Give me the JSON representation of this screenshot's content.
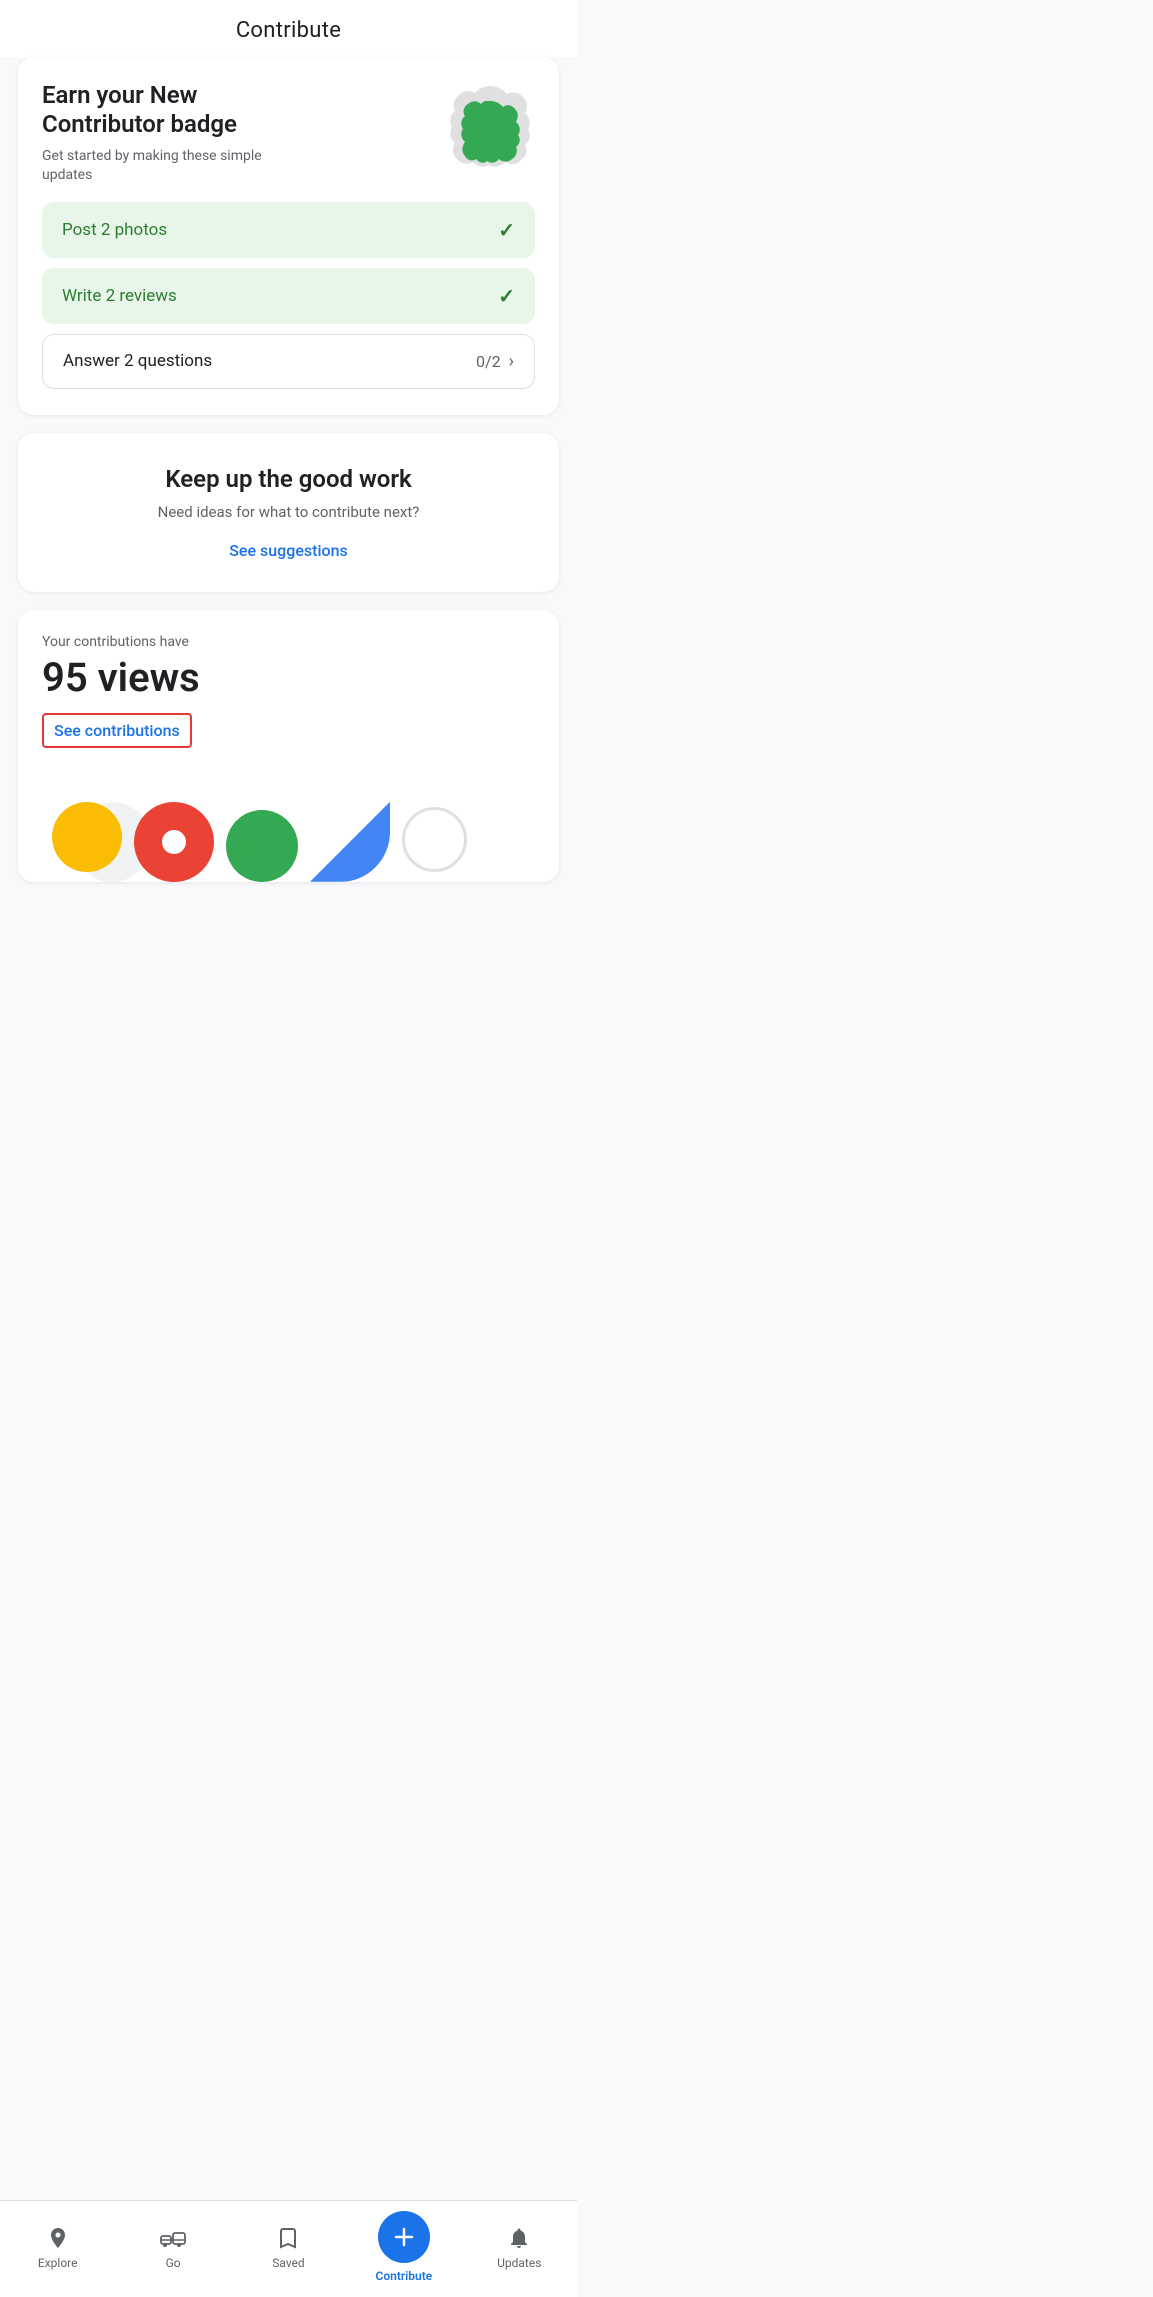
{
  "header": {
    "title": "Contribute"
  },
  "badge_card": {
    "title": "Earn your New Contributor badge",
    "subtitle": "Get started by making these simple updates",
    "tasks": [
      {
        "label": "Post 2 photos",
        "status": "completed",
        "progress": null
      },
      {
        "label": "Write 2 reviews",
        "status": "completed",
        "progress": null
      },
      {
        "label": "Answer 2 questions",
        "status": "incomplete",
        "progress": "0/2"
      }
    ]
  },
  "suggestions_card": {
    "title": "Keep up the good work",
    "subtitle": "Need ideas for what to contribute next?",
    "link_label": "See suggestions"
  },
  "views_card": {
    "label": "Your contributions have",
    "count": "95 views",
    "link_label": "See contributions"
  },
  "bottom_nav": {
    "items": [
      {
        "label": "Explore",
        "icon": "explore-icon",
        "active": false
      },
      {
        "label": "Go",
        "icon": "go-icon",
        "active": false
      },
      {
        "label": "Saved",
        "icon": "saved-icon",
        "active": false
      },
      {
        "label": "Contribute",
        "icon": "contribute-icon",
        "active": true
      },
      {
        "label": "Updates",
        "icon": "updates-icon",
        "active": false
      }
    ]
  }
}
